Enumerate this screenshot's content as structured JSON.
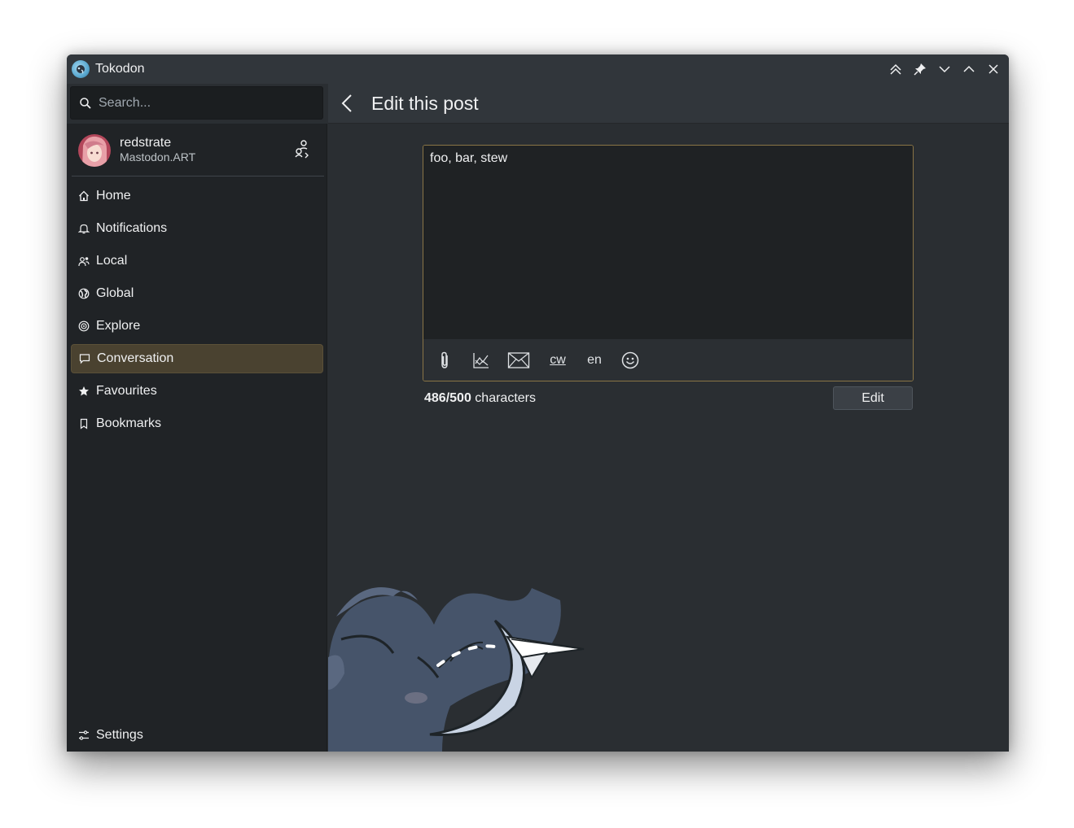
{
  "window": {
    "title": "Tokodon"
  },
  "search": {
    "placeholder": "Search..."
  },
  "account": {
    "name": "redstrate",
    "server": "Mastodon.ART"
  },
  "sidebar": {
    "items": [
      {
        "label": "Home",
        "icon": "home-icon",
        "active": false
      },
      {
        "label": "Notifications",
        "icon": "bell-icon",
        "active": false
      },
      {
        "label": "Local",
        "icon": "users-icon",
        "active": false
      },
      {
        "label": "Global",
        "icon": "globe-icon",
        "active": false
      },
      {
        "label": "Explore",
        "icon": "compass-icon",
        "active": false
      },
      {
        "label": "Conversation",
        "icon": "chat-icon",
        "active": true
      },
      {
        "label": "Favourites",
        "icon": "star-icon",
        "active": false
      },
      {
        "label": "Bookmarks",
        "icon": "bookmark-icon",
        "active": false
      }
    ],
    "settings_label": "Settings"
  },
  "page": {
    "title": "Edit this post"
  },
  "composer": {
    "text": "foo, bar, stew",
    "cw_label": "cw",
    "language": "en"
  },
  "footer": {
    "count": "486/500",
    "count_suffix": "characters",
    "edit_label": "Edit"
  },
  "colors": {
    "accent_border": "#8a7546",
    "active_nav": "#4a4230",
    "background": "#2a2e32",
    "sidebar": "#202326"
  }
}
